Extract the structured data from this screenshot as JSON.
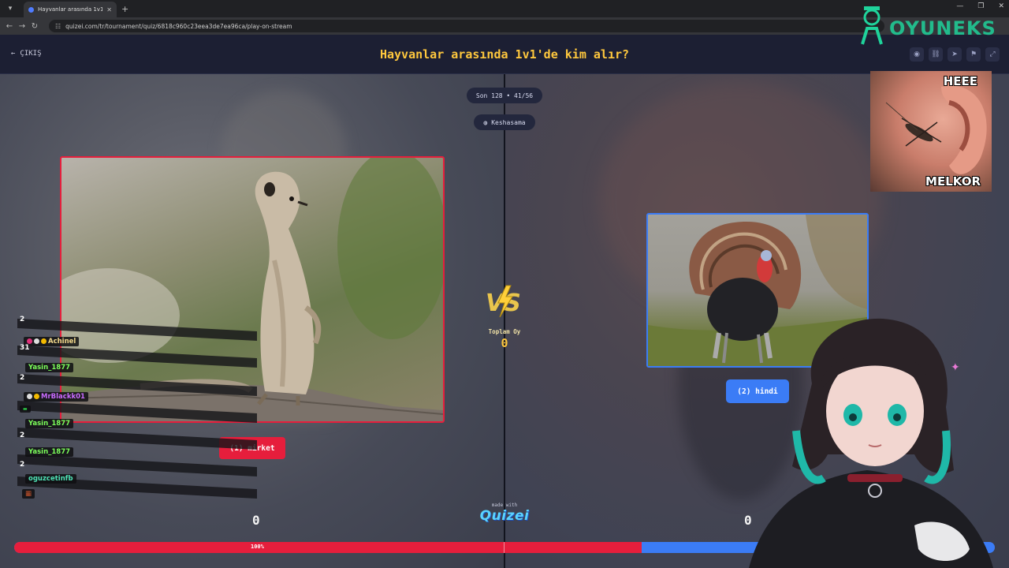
{
  "browser": {
    "tab_title": "Hayvanlar arasında 1v1'de kim ...",
    "url": "quizei.com/tr/tournament/quiz/6818c960c23eea3de7ea96ca/play-on-stream"
  },
  "header": {
    "exit_label": "ÇIKIŞ",
    "title": "Hayvanlar arasında 1v1'de kim alır?"
  },
  "round": {
    "label": "Son 128 • 41/56",
    "user": "Keshasama"
  },
  "left": {
    "option_label": "(1) mirket",
    "image_name": "meerkat-image",
    "score": "0",
    "accent": "#e61e3c"
  },
  "right": {
    "option_label": "(2) hindi",
    "image_name": "turkey-image",
    "score": "0",
    "accent": "#3b7cf6"
  },
  "center": {
    "vs_text": "VS",
    "total_label": "Toplam Oy",
    "total_value": "0",
    "made_with": "made with",
    "brand": "Quizei"
  },
  "progress": {
    "left_percent_text": "100%",
    "left_fraction": 0.64
  },
  "chat": {
    "entries": [
      {
        "name": "",
        "count": "2",
        "color": "#ffffff"
      },
      {
        "name": "Achinel",
        "count": "31",
        "color": "#f3d98c"
      },
      {
        "name": "Yasin_1877",
        "count": "2",
        "color": "#7cff5b"
      },
      {
        "name": "MrBlackk01",
        "count": "",
        "color": "#c86bff"
      },
      {
        "name": "Yasin_1877",
        "count": "2",
        "color": "#7cff5b"
      },
      {
        "name": "Yasin_1877",
        "count": "2",
        "color": "#7cff5b"
      },
      {
        "name": "oguzcetinfb",
        "count": "",
        "color": "#4fe3b6"
      }
    ]
  },
  "overlay": {
    "logo_text": "OYUNEKS",
    "meme_top": "HEEE",
    "meme_bottom": "MELKOR"
  }
}
